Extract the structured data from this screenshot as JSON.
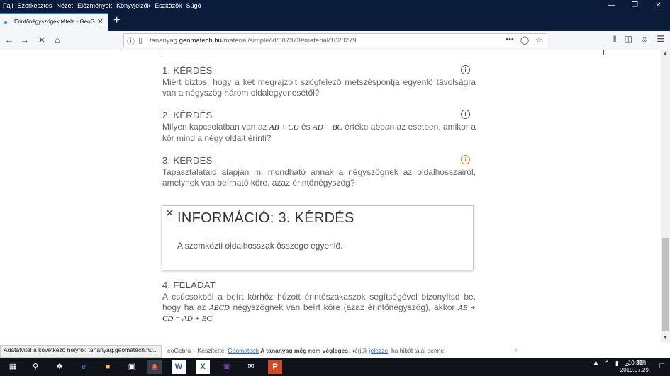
{
  "menubar": {
    "items": [
      "Fájl",
      "Szerkesztés",
      "Nézet",
      "Előzmények",
      "Könyvjelzők",
      "Eszközök",
      "Súgó"
    ]
  },
  "tab": {
    "title": "Érintőnégyszögek tétele - GeoG"
  },
  "address": {
    "url_prefix": "tananyag.",
    "url_domain": "geomatech.hu",
    "url_path": "/material/simple/id/507373#material/1028279",
    "more_label": "•••"
  },
  "questions": [
    {
      "heading": "1. KÉRDÉS",
      "text": "Miért biztos, hogy a két megrajzolt szögfelező metszéspontja egyenlő távolságra van a négyszög három oldalegyenesétől?",
      "icon_color": "#555555"
    },
    {
      "heading": "2. KÉRDÉS",
      "text_a": "Milyen kapcsolatban van az",
      "math_a": "AB + CD",
      "text_b": "és",
      "math_b": "AD + BC",
      "text_c": "értéke abban az esetben, amikor a kör mind a négy oldalt érinti?",
      "icon_color": "#555555"
    },
    {
      "heading": "3. KÉRDÉS",
      "text": "Tapasztalataid alapján mi mondható annak a négyszögnek az oldalhosszairól, amelynek van beírható köre, azaz érintőnégyszög?",
      "icon_color": "#e87c19"
    }
  ],
  "infobox": {
    "title": "INFORMÁCIÓ: 3. KÉRDÉS",
    "text": "A szemközti oldalhosszak összege egyenlő."
  },
  "task": {
    "heading": "4. FELADAT",
    "text_a": "A csúcsokból a beírt körhöz húzott érintőszakaszok segítségével bizonyítsd be, hogy ha az",
    "math_a": "ABCD",
    "text_b": "négyszögnek van beírt köre (azaz érintőnégyszög), akkor",
    "math_b": "AB + CD = AD + BC",
    "text_c": "!"
  },
  "status": {
    "transfer": "Adatátvitel a következő helyről: tananyag.geomatech.hu...",
    "footer_brand": "eoGebra",
    "footer_made": " – Készítette: ",
    "footer_link": "Geomatech",
    "footer_bold": " A tananyag még nem végleges",
    "footer_ask": ", kérjük ",
    "footer_report": "jelezze",
    "footer_end": ", ha hibát talál benne!"
  },
  "taskbar": {
    "time": "10:32",
    "date": "2019.07.29."
  }
}
